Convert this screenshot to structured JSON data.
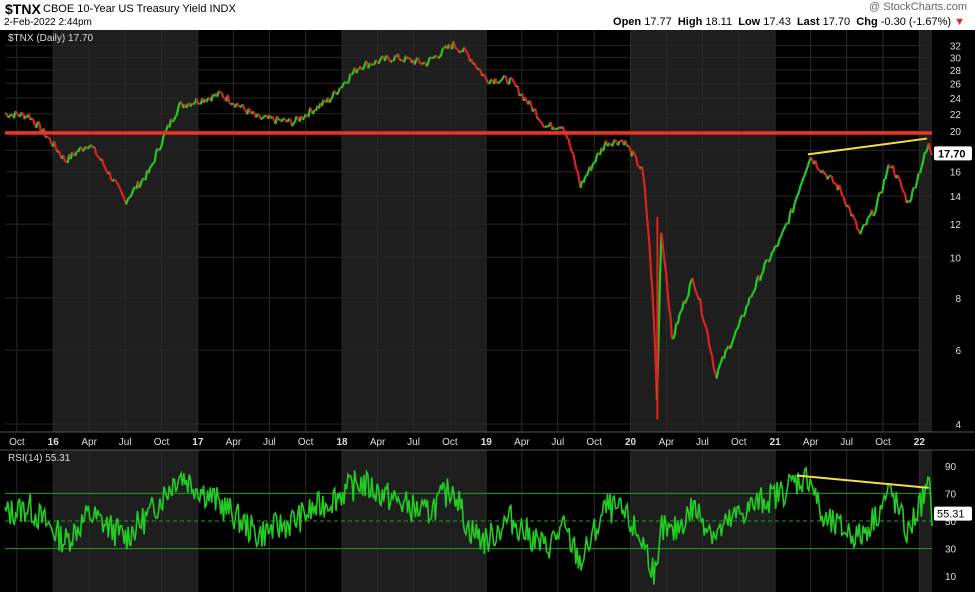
{
  "header": {
    "symbol": "$TNX",
    "name": "CBOE 10-Year US Treasury Yield",
    "exchange": "INDX",
    "datetime": "2-Feb-2022 2:44pm",
    "brand": "@ StockCharts.com",
    "open_label": "Open",
    "open": "17.77",
    "high_label": "High",
    "high": "18.11",
    "low_label": "Low",
    "low": "17.43",
    "last_label": "Last",
    "last": "17.70",
    "chg_label": "Chg",
    "chg": "-0.30 (-1.67%)",
    "chg_arrow": "▼"
  },
  "chart_data": [
    {
      "type": "line",
      "panel": "price",
      "legend": "$TNX (Daily) 17.70",
      "last_value_label": "17.70",
      "y_scale": "log",
      "ylim": [
        4,
        33
      ],
      "y_ticks": [
        4,
        6,
        8,
        10,
        12,
        14,
        16,
        18,
        20,
        22,
        24,
        26,
        28,
        30,
        32
      ],
      "x_tick_labels": [
        "Oct",
        "16",
        "Apr",
        "Jul",
        "Oct",
        "17",
        "Apr",
        "Jul",
        "Oct",
        "18",
        "Apr",
        "Jul",
        "Oct",
        "19",
        "Apr",
        "Jul",
        "Oct",
        "20",
        "Apr",
        "Jul",
        "Oct",
        "21",
        "Apr",
        "Jul",
        "Oct",
        "22"
      ],
      "x_range": [
        "2015-09-01",
        "2022-02-02"
      ],
      "series": [
        {
          "dates": [
            "2015-09-01",
            "2015-11-01",
            "2016-02-01",
            "2016-04-01",
            "2016-07-01",
            "2016-09-01",
            "2016-11-15",
            "2017-03-01",
            "2017-06-01",
            "2017-09-01",
            "2017-12-01",
            "2018-02-15",
            "2018-05-15",
            "2018-08-01",
            "2018-10-10",
            "2018-11-15",
            "2019-01-01",
            "2019-03-01",
            "2019-06-01",
            "2019-07-15",
            "2019-08-28",
            "2019-11-01",
            "2019-12-15",
            "2020-02-01",
            "2020-03-09",
            "2020-03-19",
            "2020-04-15",
            "2020-06-08",
            "2020-08-04",
            "2020-10-01",
            "2020-12-01",
            "2021-01-15",
            "2021-02-15",
            "2021-03-31",
            "2021-05-01",
            "2021-06-15",
            "2021-08-04",
            "2021-09-15",
            "2021-10-20",
            "2021-12-03",
            "2021-12-15",
            "2022-01-25",
            "2022-02-02"
          ],
          "values": [
            22.0,
            21.8,
            17.0,
            18.7,
            13.6,
            16.0,
            23.0,
            24.5,
            21.5,
            21.0,
            23.8,
            28.6,
            30.0,
            29.0,
            32.2,
            30.5,
            26.6,
            26.5,
            20.5,
            20.7,
            14.8,
            18.8,
            19.0,
            16.0,
            4.2,
            11.5,
            6.3,
            8.9,
            5.2,
            6.8,
            9.3,
            11.0,
            13.0,
            17.4,
            16.1,
            14.5,
            11.3,
            13.2,
            16.8,
            13.5,
            14.2,
            18.5,
            17.7
          ]
        }
      ],
      "annotations": [
        {
          "kind": "horizontal-line",
          "color": "#ee3322",
          "value": 19.8
        },
        {
          "kind": "trendline",
          "color": "#f0e040",
          "x": [
            "2021-03-25",
            "2022-01-20"
          ],
          "y": [
            17.6,
            19.2
          ]
        }
      ]
    },
    {
      "type": "line",
      "panel": "indicator",
      "legend": "RSI(14) 55.31",
      "last_value_label": "55.31",
      "ylim": [
        0,
        100
      ],
      "y_ticks": [
        10,
        30,
        50,
        70,
        90
      ],
      "reference_lines": [
        30,
        50,
        70
      ],
      "series": [
        {
          "dates": [
            "2015-09-01",
            "2015-11-01",
            "2016-02-01",
            "2016-04-01",
            "2016-07-01",
            "2016-09-01",
            "2016-11-15",
            "2017-03-01",
            "2017-06-01",
            "2017-09-01",
            "2017-12-01",
            "2018-02-15",
            "2018-05-15",
            "2018-08-01",
            "2018-10-10",
            "2018-11-15",
            "2019-01-01",
            "2019-03-01",
            "2019-06-01",
            "2019-07-15",
            "2019-08-28",
            "2019-11-01",
            "2019-12-15",
            "2020-02-01",
            "2020-03-09",
            "2020-03-19",
            "2020-04-15",
            "2020-06-08",
            "2020-08-04",
            "2020-10-01",
            "2020-12-01",
            "2021-01-15",
            "2021-02-15",
            "2021-03-31",
            "2021-05-01",
            "2021-06-15",
            "2021-08-04",
            "2021-09-15",
            "2021-10-20",
            "2021-12-03",
            "2021-12-15",
            "2022-01-25",
            "2022-02-02"
          ],
          "values": [
            55,
            60,
            35,
            55,
            38,
            55,
            84,
            62,
            40,
            50,
            65,
            78,
            65,
            55,
            75,
            45,
            35,
            52,
            30,
            45,
            20,
            60,
            55,
            35,
            8,
            45,
            40,
            60,
            40,
            55,
            65,
            70,
            78,
            82,
            50,
            45,
            38,
            55,
            72,
            40,
            50,
            75,
            55.31
          ]
        }
      ],
      "annotations": [
        {
          "kind": "trendline",
          "color": "#f0e040",
          "x": [
            "2021-02-25",
            "2022-01-25"
          ],
          "y": [
            83,
            74
          ]
        }
      ]
    }
  ],
  "colors": {
    "background": "#000000",
    "alt_band": "#1e1e1e",
    "up": "#22cc22",
    "down": "#dd2222",
    "rsi_line": "#22cc22",
    "rsi_ref": "#1aa31a",
    "resistance": "#ee3322",
    "trendline": "#f0e040",
    "axis_text": "#dddddd"
  }
}
